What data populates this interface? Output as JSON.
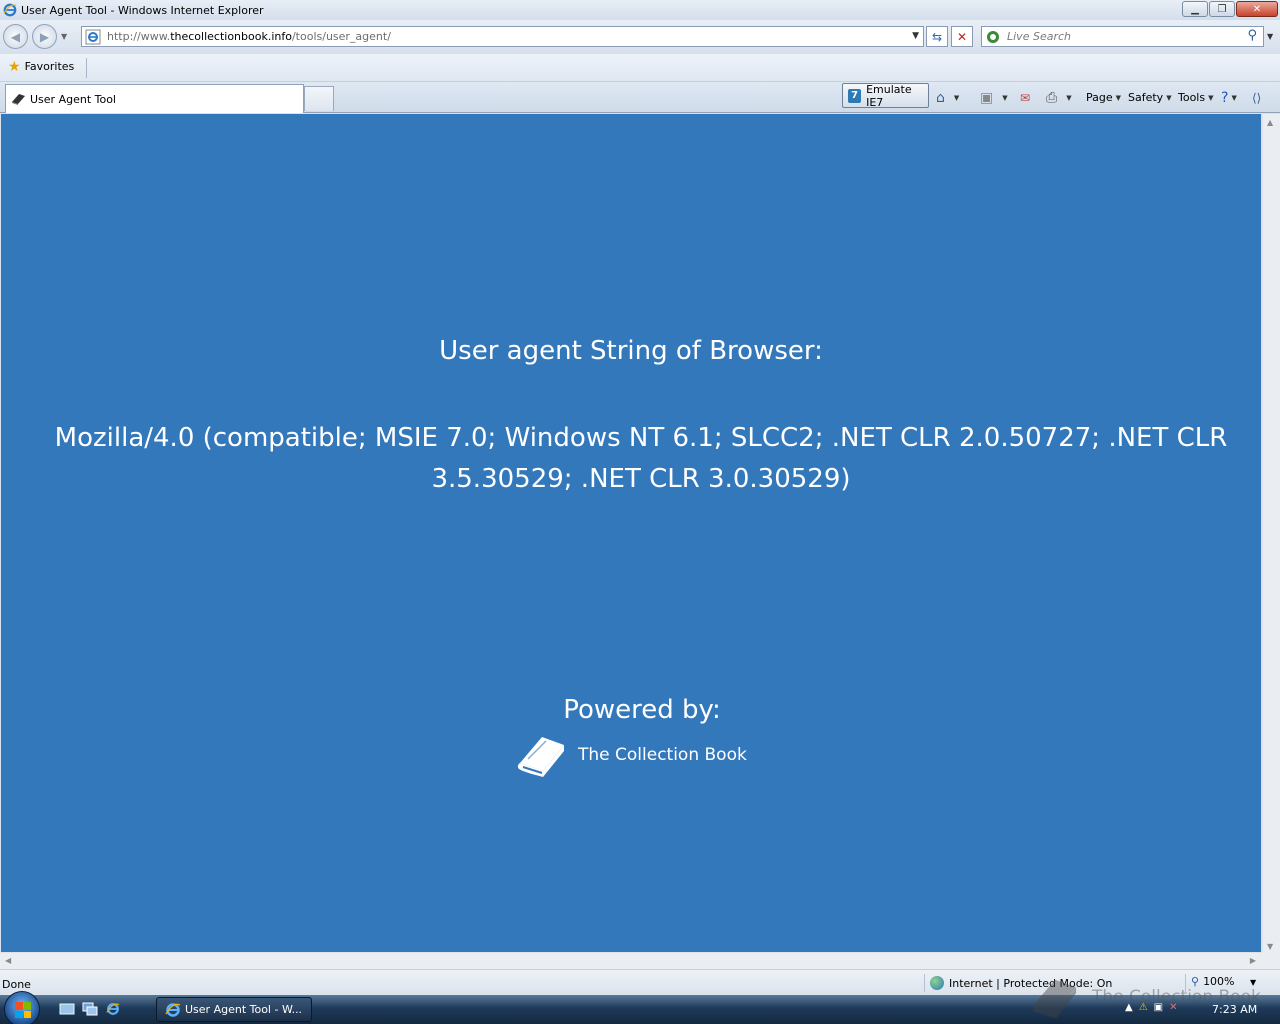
{
  "window": {
    "title": "User Agent Tool - Windows Internet Explorer"
  },
  "nav": {
    "url_prefix": "http://www.",
    "url_host": "thecollectionbook.info",
    "url_path": "/tools/user_agent/",
    "search_placeholder": "Live Search"
  },
  "favorites": {
    "label": "Favorites"
  },
  "tabs": [
    {
      "label": "User Agent Tool"
    }
  ],
  "commands": {
    "emulate": "Emulate IE7",
    "page": "Page",
    "safety": "Safety",
    "tools": "Tools"
  },
  "content": {
    "heading": "User agent String of Browser:",
    "user_agent": "Mozilla/4.0 (compatible; MSIE 7.0; Windows NT 6.1; SLCC2; .NET CLR 2.0.50727; .NET CLR 3.5.30529; .NET CLR 3.0.30529)",
    "powered_by": "Powered by:",
    "brand": "The Collection Book",
    "background": "#3478bc"
  },
  "status": {
    "text": "Done",
    "zone": "Internet | Protected Mode: On",
    "zoom": "100%"
  },
  "taskbar": {
    "task_label": "User Agent Tool - W...",
    "time": "7:23 AM"
  },
  "watermark": {
    "text": "The Collection Book"
  }
}
